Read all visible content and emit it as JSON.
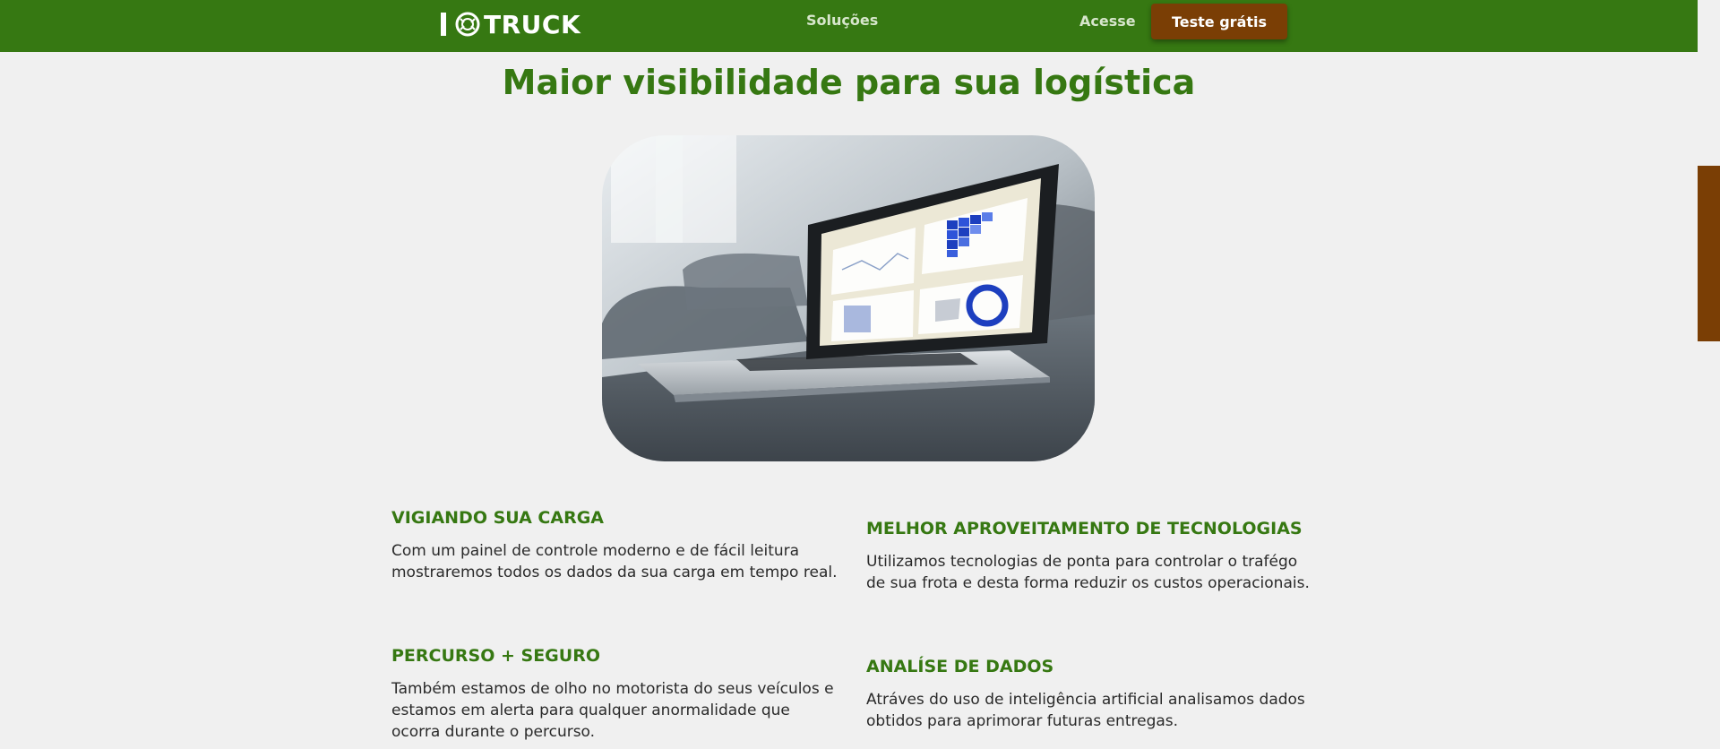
{
  "header": {
    "brand": "TRUCK",
    "nav_solucoes": "Soluções",
    "nav_acesse": "Acesse",
    "cta_label": "Teste grátis"
  },
  "hero": {
    "title": "Maior visibilidade para sua logística"
  },
  "features": [
    {
      "title": "VIGIANDO SUA CARGA",
      "text": "Com um painel de controle moderno e de fácil leitura mostraremos todos os dados da sua carga em tempo real."
    },
    {
      "title": "MELHOR APROVEITAMENTO DE TECNOLOGIAS",
      "text": "Utilizamos tecnologias de ponta para controlar o trafégo de sua frota e desta forma reduzir os custos operacionais."
    },
    {
      "title": "PERCURSO + SEGURO",
      "text": "Também estamos de olho no motorista do seus veículos e estamos em alerta para qualquer anormalidade que ocorra durante o percurso."
    },
    {
      "title": "ANALÍSE DE DADOS",
      "text": "Atráves do uso de inteligência artificial analisamos dados obtidos para aprimorar futuras entregas."
    }
  ],
  "colors": {
    "brand_green": "#367812",
    "accent_brown": "#7a3e05",
    "background": "#f0f0f0"
  },
  "icons": {
    "logo_mark": "tire-icon"
  }
}
